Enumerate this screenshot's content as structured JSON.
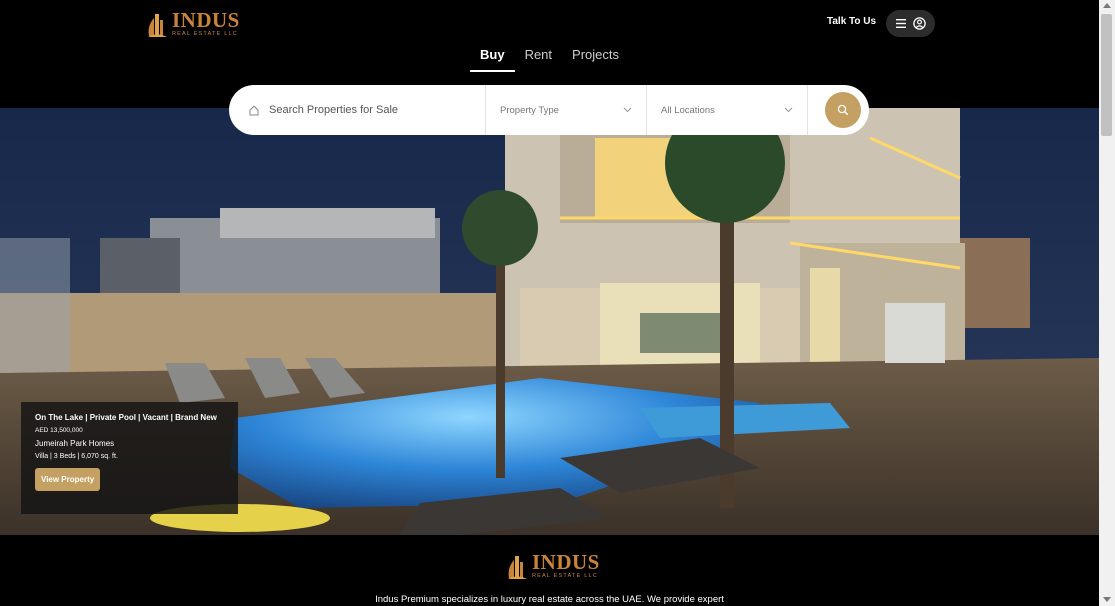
{
  "header": {
    "logo_name": "INDUS",
    "logo_sub": "REAL ESTATE LLC",
    "talk_label": "Talk To Us",
    "menu_icon": "hamburger-icon",
    "account_icon": "user-circle-icon"
  },
  "tabs": [
    {
      "label": "Buy",
      "active": true
    },
    {
      "label": "Rent",
      "active": false
    },
    {
      "label": "Projects",
      "active": false
    }
  ],
  "search": {
    "placeholder": "Search Properties for Sale",
    "property_type": "Property Type",
    "location": "All Locations",
    "search_icon": "search-icon"
  },
  "featured": {
    "title": "On The Lake | Private Pool | Vacant | Brand New",
    "price": "AED 13,500,000",
    "location": "Jumeirah Park Homes",
    "specs": "Villa | 3 Beds | 6,070 sq. ft.",
    "button": "View Property"
  },
  "footer": {
    "logo_name": "INDUS",
    "logo_sub": "REAL ESTATE LLC",
    "tagline": "Indus Premium specializes in luxury real estate across the UAE. We provide expert"
  },
  "colors": {
    "brand": "#c9843a",
    "accent": "#c4a062",
    "background": "#000000"
  }
}
